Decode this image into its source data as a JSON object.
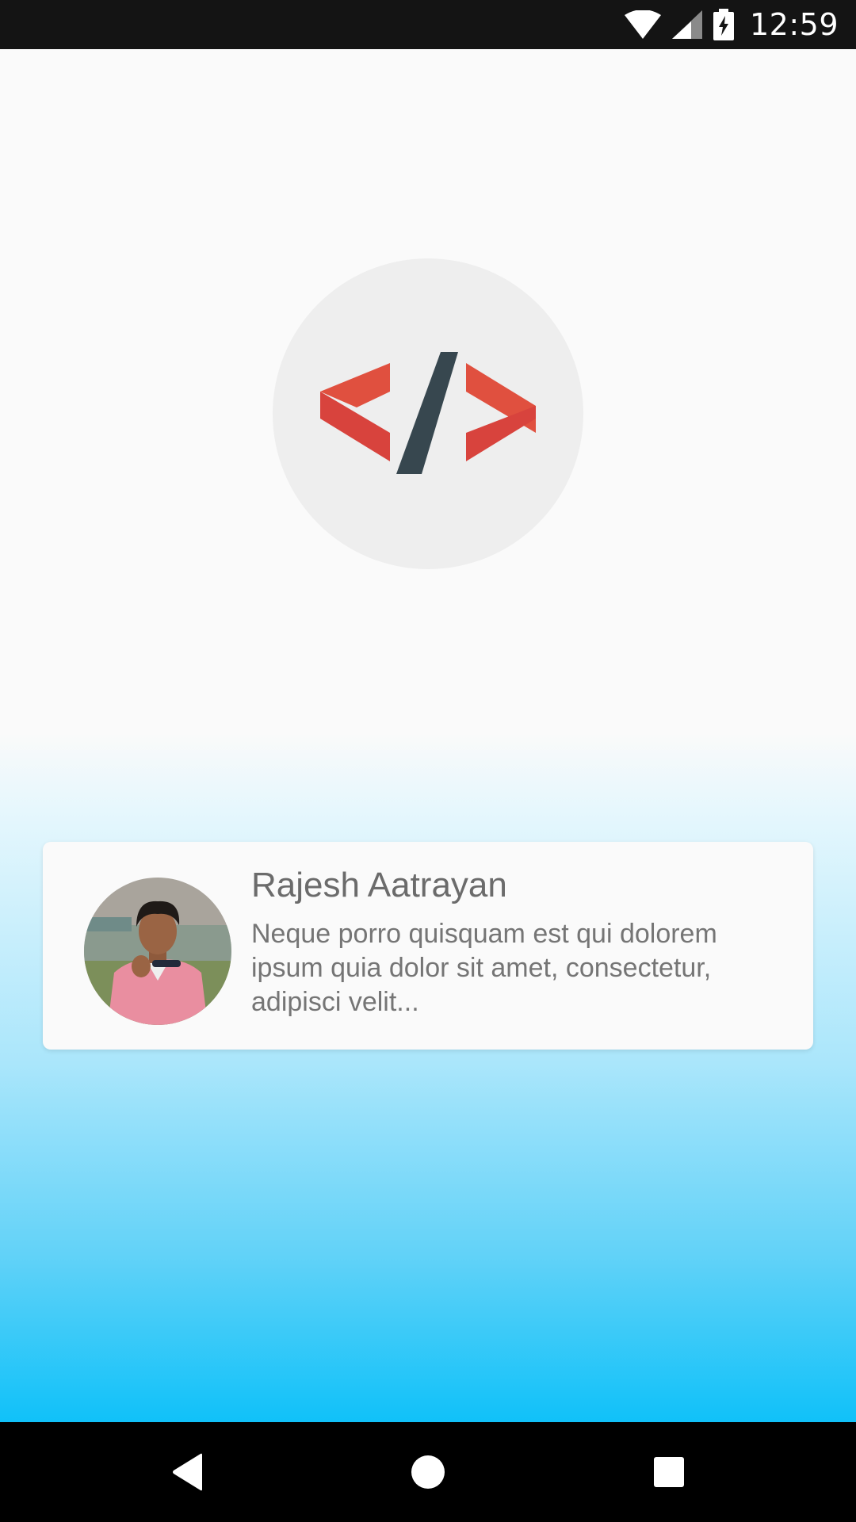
{
  "status_bar": {
    "time": "12:59",
    "icons": [
      "wifi-icon",
      "cell-signal-icon",
      "battery-charging-icon"
    ]
  },
  "logo": {
    "icon": "code-brackets-logo",
    "colors": {
      "bracket": "#e0503f",
      "slash": "#37474f",
      "circle": "#eeeeee"
    }
  },
  "profile": {
    "name": "Rajesh Aatrayan",
    "description": "Neque porro quisquam est qui dolorem ipsum quia dolor sit amet, consectetur, adipisci velit..."
  },
  "nav": {
    "back": "back-icon",
    "home": "home-icon",
    "recents": "recents-icon"
  },
  "colors": {
    "gradient_bottom": "#10c1f9",
    "status_bar": "#141414"
  }
}
